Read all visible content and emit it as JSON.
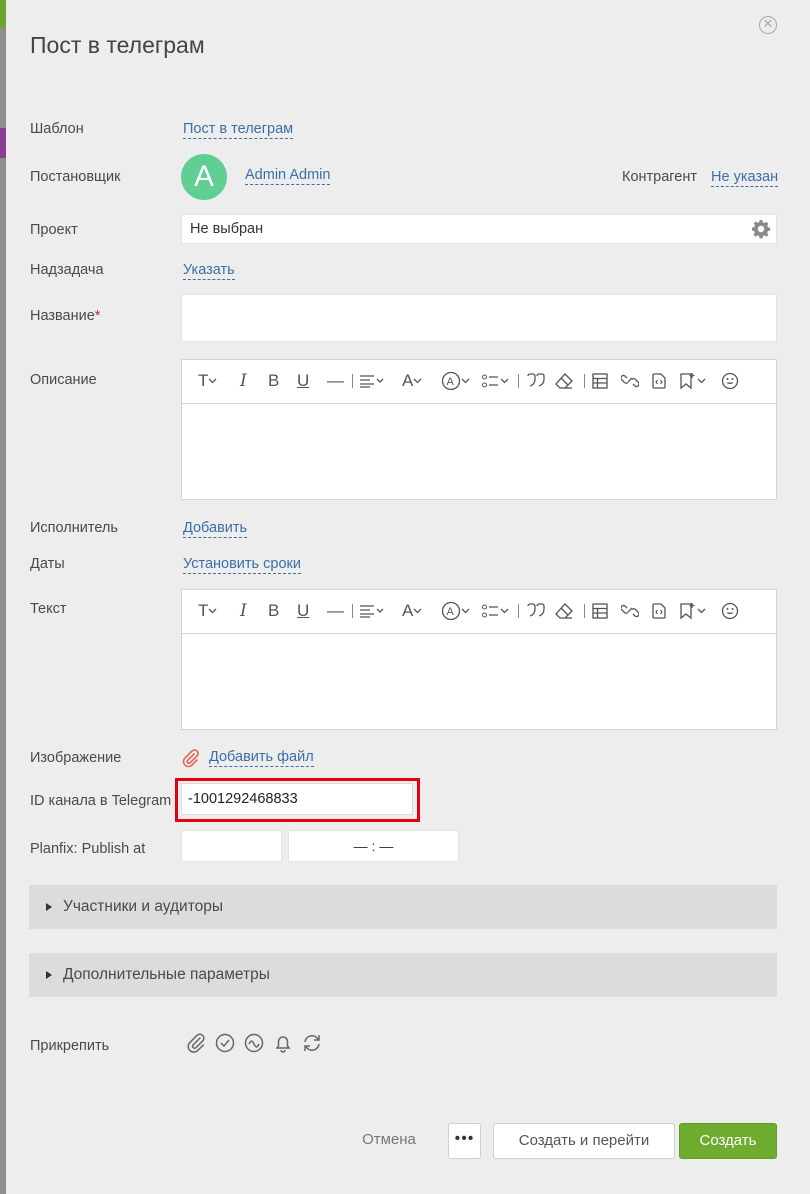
{
  "modal": {
    "title": "Пост в телеграм",
    "close_icon": "close-icon"
  },
  "form": {
    "template": {
      "label": "Шаблон",
      "value": "Пост в телеграм"
    },
    "assigner": {
      "label": "Постановщик",
      "avatar_letter": "A",
      "name": "Admin Admin"
    },
    "counterparty": {
      "label": "Контрагент",
      "value": "Не указан"
    },
    "project": {
      "label": "Проект",
      "value": "Не выбран"
    },
    "parent_task": {
      "label": "Надзадача",
      "value": "Указать"
    },
    "name": {
      "label": "Название",
      "required_mark": "*",
      "value": ""
    },
    "description": {
      "label": "Описание",
      "value": ""
    },
    "executor": {
      "label": "Исполнитель",
      "value": "Добавить"
    },
    "dates": {
      "label": "Даты",
      "value": "Установить сроки"
    },
    "text": {
      "label": "Текст",
      "value": ""
    },
    "image": {
      "label": "Изображение",
      "value": "Добавить файл"
    },
    "channel_id": {
      "label": "ID канала в Telegram",
      "value": "-1001292468833"
    },
    "publish_at": {
      "label": "Planfix: Publish at",
      "date": "",
      "time": "— : —"
    }
  },
  "sections": {
    "participants": "Участники и аудиторы",
    "extra": "Дополнительные параметры"
  },
  "attach": {
    "label": "Прикрепить"
  },
  "footer": {
    "cancel": "Отмена",
    "more": "•••",
    "create_and_go": "Создать и перейти",
    "create": "Создать"
  },
  "colors": {
    "accent_green": "#6eab2f",
    "avatar_green": "#5fcf93",
    "link_blue": "#3b6fa8",
    "highlight_red": "#e3000f"
  }
}
